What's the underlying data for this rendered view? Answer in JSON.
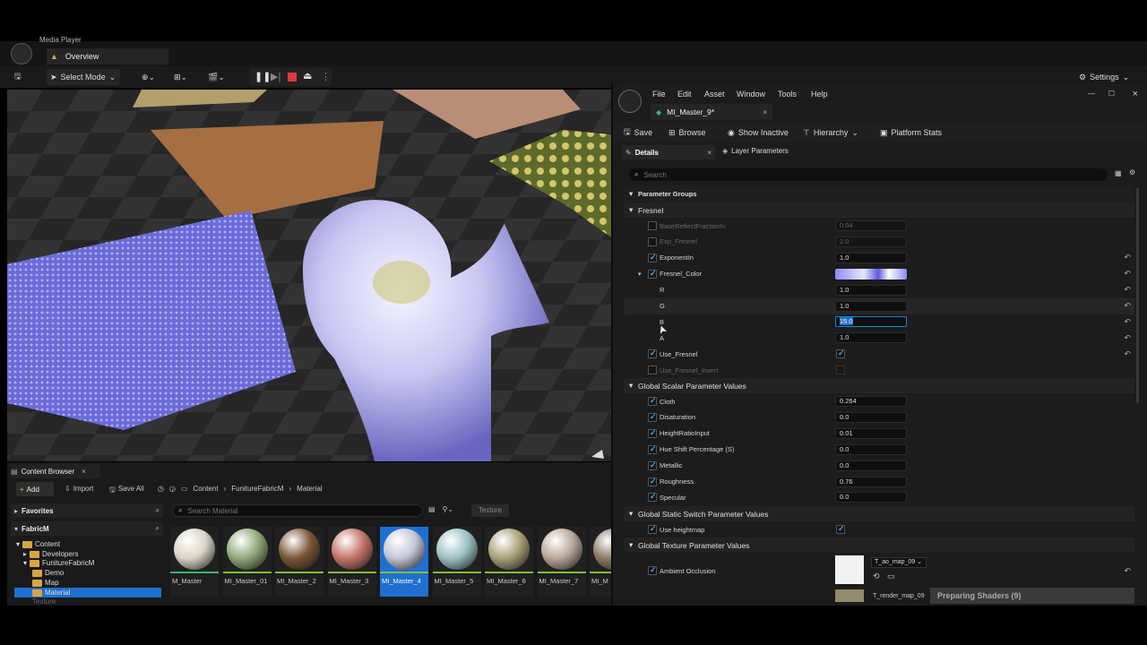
{
  "topbar": {
    "app_title": "Media Player",
    "tab": "Overview"
  },
  "toolbar": {
    "select_mode": "Select Mode",
    "settings": "Settings"
  },
  "content_browser": {
    "tab": "Content Browser",
    "add": "Add",
    "import": "Import",
    "save_all": "Save All",
    "breadcrumb": [
      "Content",
      "FunitureFabricM",
      "Material"
    ],
    "search_placeholder": "Search Material",
    "filter_chip": "Texture",
    "favorites": "Favorites",
    "project": "FabricM",
    "tree": [
      "Content",
      "Developers",
      "FunitureFabricM",
      "Demo",
      "Map",
      "Material",
      "Texture"
    ],
    "assets": [
      {
        "name": "M_Master",
        "color": "#d9d4c5"
      },
      {
        "name": "MI_Master_01",
        "color": "#8fa878"
      },
      {
        "name": "MI_Master_2",
        "color": "#7a5537"
      },
      {
        "name": "MI_Master_3",
        "color": "#c47468"
      },
      {
        "name": "MI_Master_4",
        "color": "#c4c4d8"
      },
      {
        "name": "MI_Master_5",
        "color": "#9cc0c4"
      },
      {
        "name": "MI_Master_6",
        "color": "#a8a077"
      },
      {
        "name": "MI_Master_7",
        "color": "#b8a69a"
      },
      {
        "name": "MI_M",
        "color": "#8a7a66"
      }
    ]
  },
  "editor": {
    "menu": [
      "File",
      "Edit",
      "Asset",
      "Window",
      "Tools",
      "Help"
    ],
    "asset_tab": "MI_Master_9*",
    "toolbar": {
      "save": "Save",
      "browse": "Browse",
      "show_inactive": "Show Inactive",
      "hierarchy": "Hierarchy",
      "platform_stats": "Platform Stats"
    },
    "tabs": {
      "details": "Details",
      "layer_parameters": "Layer Parameters"
    },
    "search_placeholder": "Search",
    "parameter_groups": "Parameter Groups",
    "fresnel": {
      "title": "Fresnel",
      "rows": [
        {
          "label": "BaseReflectFractionIn",
          "value": "0.04"
        },
        {
          "label": "Exp_Fresnel",
          "value": "2.0"
        },
        {
          "label": "ExponentIn",
          "value": "1.0"
        },
        {
          "label": "Fresnel_Color",
          "value": ""
        },
        {
          "label": "R",
          "value": "1.0"
        },
        {
          "label": "G",
          "value": "1.0"
        },
        {
          "label": "B",
          "value": "15.0"
        },
        {
          "label": "A",
          "value": "1.0"
        },
        {
          "label": "Use_Fresnel",
          "value": ""
        },
        {
          "label": "Use_Fresnel_Invert",
          "value": ""
        }
      ]
    },
    "scalar": {
      "title": "Global Scalar Parameter Values",
      "rows": [
        {
          "label": "Cloth",
          "value": "0.264"
        },
        {
          "label": "Disaturation",
          "value": "0.0"
        },
        {
          "label": "HeightRatioInput",
          "value": "0.01"
        },
        {
          "label": "Hue Shift Percentage (S)",
          "value": "0.0"
        },
        {
          "label": "Metallic",
          "value": "0.0"
        },
        {
          "label": "Roughness",
          "value": "0.76"
        },
        {
          "label": "Specular",
          "value": "0.0"
        }
      ]
    },
    "static_switch": {
      "title": "Global Static Switch Parameter Values",
      "row": "Use heightmap"
    },
    "texture": {
      "title": "Global Texture Parameter Values",
      "row": "Ambient Occlusion",
      "map1": "T_ao_map_09",
      "map2": "T_render_map_09"
    },
    "toast": "Preparing Shaders (9)"
  },
  "colors": {
    "accent": "#0e86d4",
    "selection": "#1f6fd1",
    "fresnel_swatch": "#8a8cff"
  }
}
